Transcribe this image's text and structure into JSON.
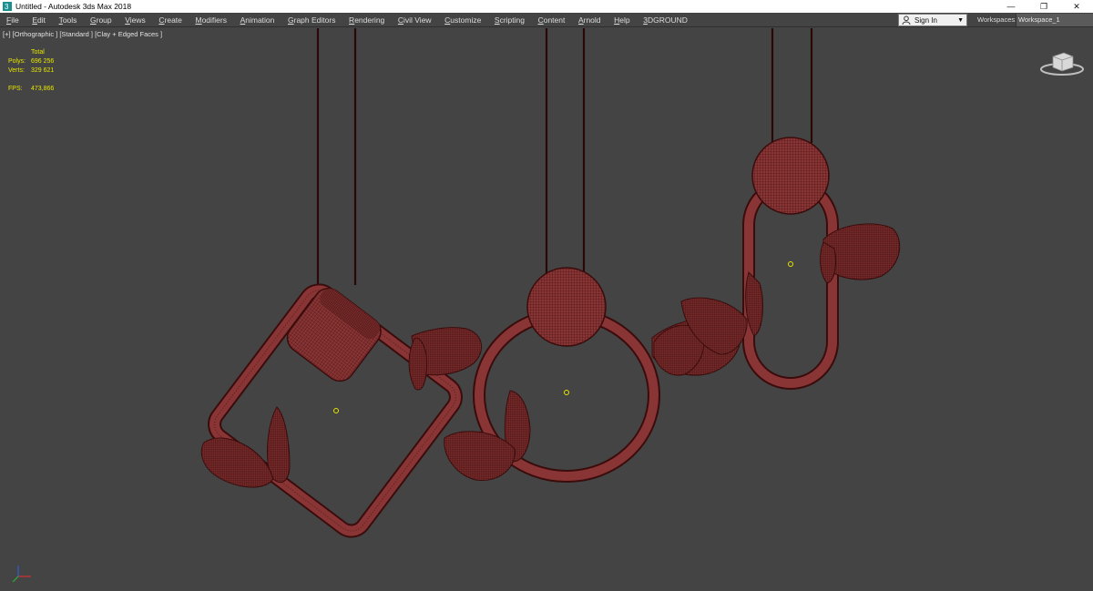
{
  "window": {
    "title": "Untitled - Autodesk 3ds Max 2018",
    "controls": {
      "minimize": "—",
      "restore": "❐",
      "close": "✕"
    }
  },
  "menubar": {
    "items": [
      "File",
      "Edit",
      "Tools",
      "Group",
      "Views",
      "Create",
      "Modifiers",
      "Animation",
      "Graph Editors",
      "Rendering",
      "Civil View",
      "Customize",
      "Scripting",
      "Content",
      "Arnold",
      "Help",
      "3DGROUND"
    ],
    "signin_label": "Sign In",
    "workspaces_label": "Workspaces:",
    "workspace_value": "Workspace_1"
  },
  "viewport": {
    "label": "[+] [Orthographic ] [Standard ] [Clay + Edged Faces ]",
    "stats": {
      "header": "Total",
      "polys_label": "Polys:",
      "polys_value": "696 256",
      "verts_label": "Verts:",
      "verts_value": "329 621",
      "fps_label": "FPS:",
      "fps_value": "473,866"
    }
  },
  "colors": {
    "background": "#444444",
    "mesh_fill": "#8a3535",
    "mesh_wire": "#3a0c0c",
    "stats_text": "#e6e600"
  },
  "icons": [
    "app-icon",
    "user-icon",
    "viewcube-icon",
    "axis-gizmo-icon"
  ]
}
